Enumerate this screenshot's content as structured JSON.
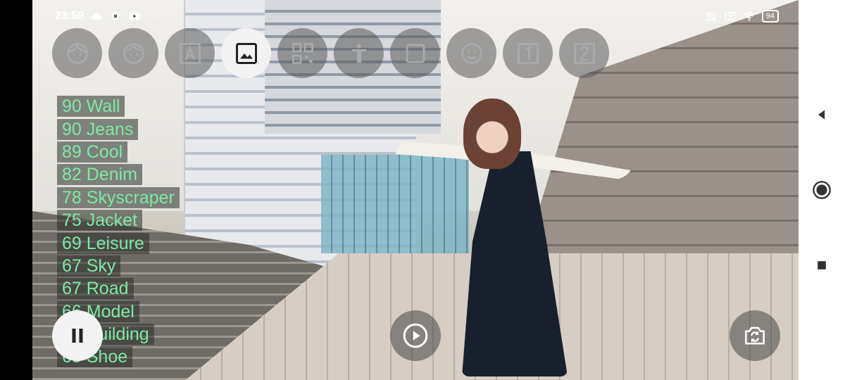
{
  "statusbar": {
    "time": "23:59",
    "more": "···",
    "battery": "94"
  },
  "mode_buttons": [
    {
      "icon": "face-icon",
      "active": false
    },
    {
      "icon": "face-outline-icon",
      "active": false
    },
    {
      "icon": "text-a-icon",
      "active": false
    },
    {
      "icon": "image-icon",
      "active": true
    },
    {
      "icon": "qr-code-icon",
      "active": false
    },
    {
      "icon": "person-icon",
      "active": false
    },
    {
      "icon": "square-icon",
      "active": false
    },
    {
      "icon": "face-smile-icon",
      "active": false
    },
    {
      "icon": "number-1-icon",
      "active": false
    },
    {
      "icon": "number-2-icon",
      "active": false
    }
  ],
  "labels": [
    {
      "text": "90 Wall"
    },
    {
      "text": "90 Jeans"
    },
    {
      "text": "89 Cool"
    },
    {
      "text": "82 Denim"
    },
    {
      "text": "78 Skyscraper"
    },
    {
      "text": "75 Jacket"
    },
    {
      "text": "69 Leisure"
    },
    {
      "text": "67 Sky"
    },
    {
      "text": "67 Road"
    },
    {
      "text": "66 Model"
    },
    {
      "text": "66 Building"
    },
    {
      "text": "65 Shoe"
    }
  ],
  "controls": {
    "pause": "pause-icon",
    "play": "play-icon",
    "switch_camera": "switch-camera-icon"
  },
  "navbar": {
    "back": "back-icon",
    "home": "home-icon",
    "recents": "recents-icon"
  },
  "colors": {
    "label_text": "#7ee9a4",
    "active_mode_bg": "#f2f2f2"
  }
}
